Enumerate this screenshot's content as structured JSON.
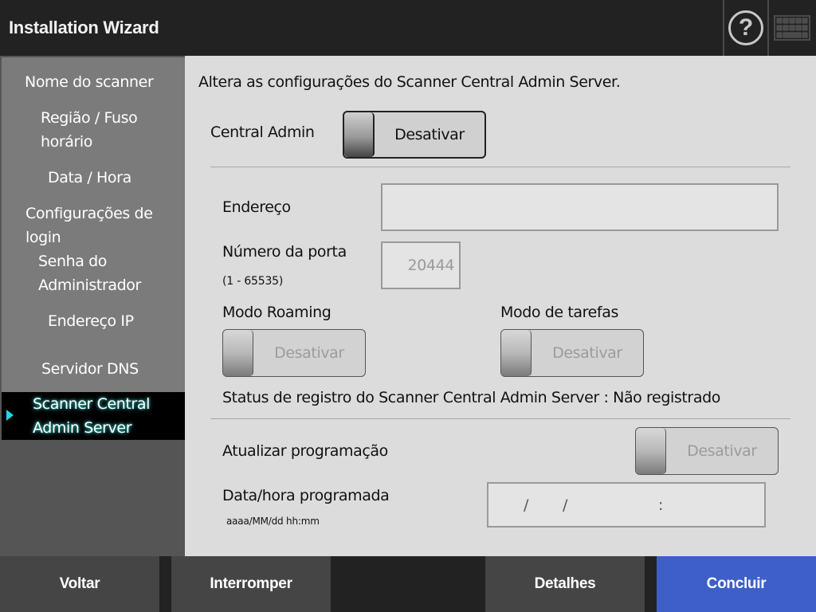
{
  "header": {
    "title": "Installation Wizard",
    "help_icon": "question-circle-icon",
    "keyboard_icon": "keyboard-icon"
  },
  "sidebar": {
    "items": [
      {
        "label": "Nome do scanner"
      },
      {
        "label": "Região / Fuso",
        "label2": "horário"
      },
      {
        "label": "Data / Hora"
      },
      {
        "label": "Configurações de",
        "label2": "login"
      },
      {
        "label": "Senha do",
        "label2": "Administrador"
      },
      {
        "label": "Endereço IP"
      },
      {
        "label": "Servidor DNS"
      },
      {
        "label": "Scanner Central",
        "label2": "Admin Server",
        "selected": true
      }
    ],
    "selected_indicator_color": "#22d3ee"
  },
  "main": {
    "description": "Altera as configurações do Scanner Central Admin Server.",
    "central_admin": {
      "label": "Central Admin",
      "toggle_label": "Desativar",
      "state": "off"
    },
    "address": {
      "label": "Endereço",
      "value": ""
    },
    "port": {
      "label": "Número da porta",
      "range_hint": "(1 - 65535)",
      "value": "20444"
    },
    "roaming": {
      "label": "Modo Roaming",
      "toggle_label": "Desativar",
      "state": "off",
      "enabled": false
    },
    "task_mode": {
      "label": "Modo de tarefas",
      "toggle_label": "Desativar",
      "state": "off",
      "enabled": false
    },
    "registration_status": {
      "label": "Status de registro do Scanner Central Admin Server",
      "separator": ":",
      "value": "Não registrado"
    },
    "update_schedule": {
      "label": "Atualizar programação",
      "toggle_label": "Desativar",
      "state": "off",
      "enabled": false
    },
    "scheduled_datetime": {
      "label": "Data/hora programada",
      "format_hint": "aaaa/MM/dd hh:mm",
      "sep1": "/",
      "sep2": "/",
      "sep3": ":",
      "value": ""
    }
  },
  "footer": {
    "back": "Voltar",
    "abort": "Interromper",
    "details": "Detalhes",
    "finish": "Concluir",
    "finish_color": "#3e5fc8"
  }
}
